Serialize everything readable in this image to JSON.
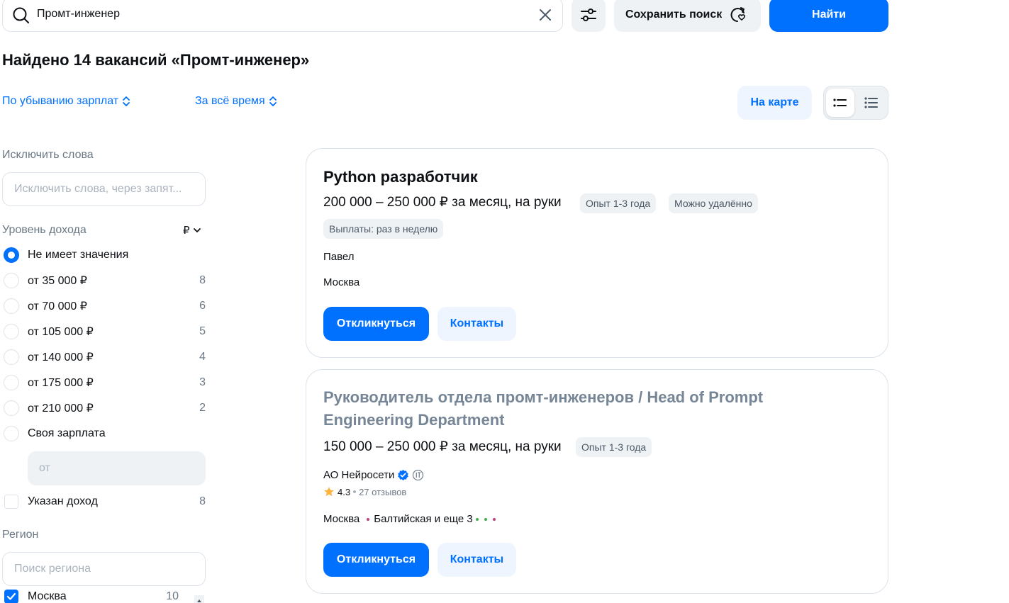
{
  "search": {
    "query": "Промт-инженер",
    "save_label": "Сохранить поиск",
    "find_label": "Найти"
  },
  "results": {
    "title": "Найдено 14 вакансий «Промт-инженер»",
    "sort_salary": "По убыванию зарплат",
    "sort_time": "За всё время",
    "map_label": "На карте"
  },
  "sidebar": {
    "exclude_label": "Исключить слова",
    "exclude_placeholder": "Исключить слова, через запят...",
    "income_label": "Уровень дохода",
    "currency": "₽",
    "income_options": [
      {
        "label": "Не имеет значения",
        "count": ""
      },
      {
        "label": "от 35 000 ₽",
        "count": "8"
      },
      {
        "label": "от 70 000 ₽",
        "count": "6"
      },
      {
        "label": "от 105 000 ₽",
        "count": "5"
      },
      {
        "label": "от 140 000 ₽",
        "count": "4"
      },
      {
        "label": "от 175 000 ₽",
        "count": "3"
      },
      {
        "label": "от 210 000 ₽",
        "count": "2"
      },
      {
        "label": "Своя зарплата",
        "count": ""
      }
    ],
    "salary_from_placeholder": "от",
    "income_specified_label": "Указан доход",
    "income_specified_count": "8",
    "region_label": "Регион",
    "region_placeholder": "Поиск региона",
    "region_first": "Москва",
    "region_first_count": "10"
  },
  "vacancies": [
    {
      "title": "Python разработчик",
      "salary": "200 000 – 250 000 ₽ за месяц, на руки",
      "tags": [
        "Опыт 1-3 года",
        "Можно удалённо"
      ],
      "payout": "Выплаты: раз в неделю",
      "company": "Павел",
      "city": "Москва",
      "apply": "Откликнуться",
      "contacts": "Контакты"
    },
    {
      "title_line1": "Руководитель отдела промт-инженеров / Head of Prompt",
      "title_line2": "Engineering Department",
      "salary": "150 000 – 250 000 ₽ за месяц, на руки",
      "tags": [
        "Опыт 1-3 года"
      ],
      "company": "АО Нейросети",
      "rating": "4.3",
      "reviews": "27 отзывов",
      "city": "Москва",
      "metro": "Балтийская и еще 3",
      "apply": "Откликнуться",
      "contacts": "Контакты"
    }
  ],
  "colors": {
    "accent": "#0070ff",
    "visited_title": "#768696",
    "star": "#ffb340"
  }
}
